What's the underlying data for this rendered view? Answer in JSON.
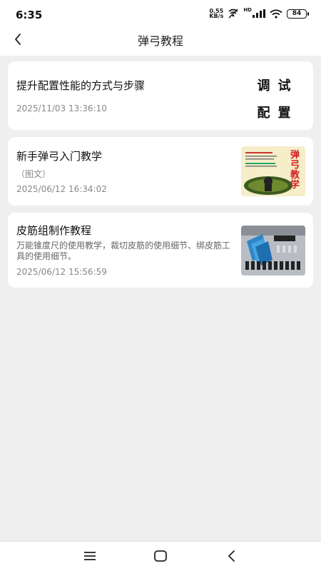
{
  "status_bar": {
    "time": "6:35",
    "net_speed_value": "0.55",
    "net_speed_unit": "KB/s",
    "hd_label": "HD",
    "battery": "84"
  },
  "nav": {
    "title": "弹弓教程"
  },
  "items": [
    {
      "title": "提升配置性能的方式与步骤",
      "date": "2025/11/03 13:36:10",
      "thumb_chars": [
        "调",
        "试",
        "配",
        "置"
      ]
    },
    {
      "title": "新手弹弓入门教学",
      "subtitle": "（图文）",
      "date": "2025/06/12 16:34:02",
      "thumb_title": "弹弓教学"
    },
    {
      "title": "皮筋组制作教程",
      "description": "万能锥度尺的使用教学，裁切皮筋的使用细节、绑皮筋工具的使用细节。",
      "date": "2025/06/12 15:56:59"
    }
  ],
  "colors": {
    "background": "#efefef",
    "card": "#ffffff",
    "date_text": "#888888"
  }
}
